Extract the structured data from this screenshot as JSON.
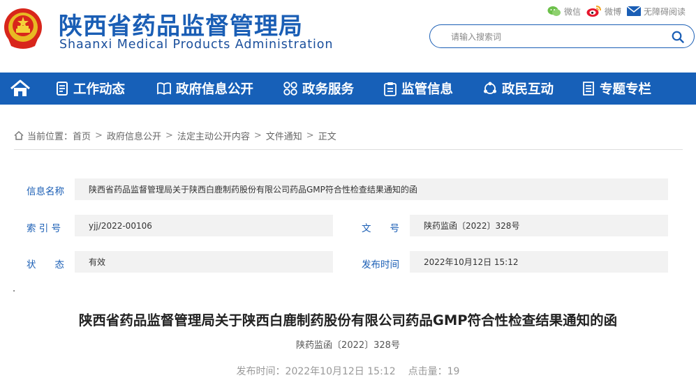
{
  "header": {
    "title_cn": "陕西省药品监督管理局",
    "title_en": "Shaanxi Medical Products Administration",
    "tools": [
      {
        "label": "微信",
        "icon": "wechat-icon"
      },
      {
        "label": "微博",
        "icon": "weibo-icon"
      },
      {
        "label": "无障碍阅读",
        "icon": "envelope-icon"
      }
    ],
    "search": {
      "placeholder": "请输入搜索词"
    }
  },
  "nav": {
    "items": [
      {
        "label": "工作动态",
        "icon": "document-list-icon"
      },
      {
        "label": "政府信息公开",
        "icon": "book-icon"
      },
      {
        "label": "政务服务",
        "icon": "service-grid-icon"
      },
      {
        "label": "监管信息",
        "icon": "clipboard-icon"
      },
      {
        "label": "政民互动",
        "icon": "interaction-icon"
      },
      {
        "label": "专题专栏",
        "icon": "column-icon"
      }
    ]
  },
  "breadcrumb": {
    "prefix": "当前位置：",
    "items": [
      "首页",
      "政府信息公开",
      "法定主动公开内容",
      "文件通知",
      "正文"
    ],
    "separator": ">"
  },
  "info": {
    "name_label": "信息名称",
    "name_value": "陕西省药品监督管理局关于陕西白鹿制药股份有限公司药品GMP符合性检查结果通知的函",
    "index_label": "索 引 号",
    "index_value": "yjj/2022-00106",
    "doc_label": "文　　号",
    "doc_value": "陕药监函〔2022〕328号",
    "status_label": "状　　态",
    "status_value": "有效",
    "date_label": "发布时间",
    "date_value": "2022年10月12日 15:12"
  },
  "article": {
    "dot": ".",
    "title": "陕西省药品监督管理局关于陕西白鹿制药股份有限公司药品GMP符合性检查结果通知的函",
    "doc_number": "陕药监函〔2022〕328号",
    "publish_label": "发布时间：",
    "publish_time": "2022年10月12日 15:12",
    "hits_label": "点击量：",
    "hits": "19"
  },
  "colors": {
    "primary": "#1760b8",
    "label": "#1a5eb5",
    "field_bg": "#f2f2f2"
  }
}
